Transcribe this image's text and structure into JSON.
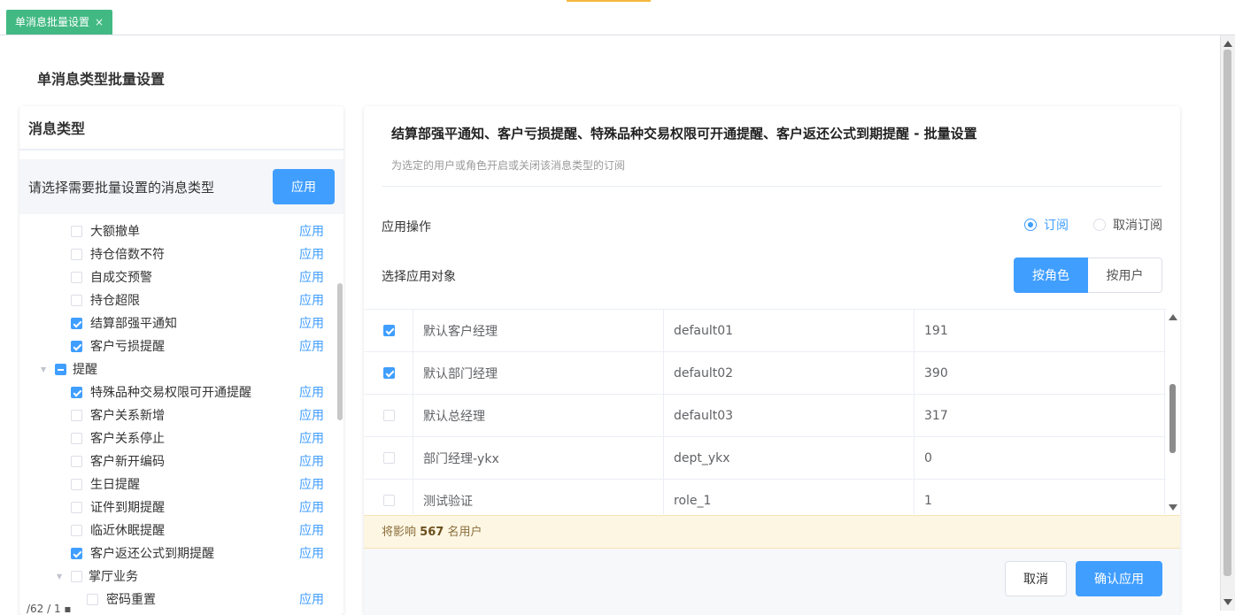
{
  "tab": {
    "label": "单消息批量设置",
    "close": "×"
  },
  "page_title": "单消息类型批量设置",
  "left": {
    "header": "消息类型",
    "prompt": "请选择需要批量设置的消息类型",
    "apply_button": "应用",
    "items": [
      {
        "label": "大额撤单",
        "checked": false,
        "apply": "应用"
      },
      {
        "label": "持仓倍数不符",
        "checked": false,
        "apply": "应用"
      },
      {
        "label": "自成交预警",
        "checked": false,
        "apply": "应用"
      },
      {
        "label": "持仓超限",
        "checked": false,
        "apply": "应用"
      },
      {
        "label": "结算部强平通知",
        "checked": true,
        "apply": "应用"
      },
      {
        "label": "客户亏损提醒",
        "checked": true,
        "apply": "应用"
      }
    ],
    "group": {
      "label": "提醒",
      "state": "indeterminate"
    },
    "group_items": [
      {
        "label": "特殊品种交易权限可开通提醒",
        "checked": true,
        "apply": "应用"
      },
      {
        "label": "客户关系新增",
        "checked": false,
        "apply": "应用"
      },
      {
        "label": "客户关系停止",
        "checked": false,
        "apply": "应用"
      },
      {
        "label": "客户新开编码",
        "checked": false,
        "apply": "应用"
      },
      {
        "label": "生日提醒",
        "checked": false,
        "apply": "应用"
      },
      {
        "label": "证件到期提醒",
        "checked": false,
        "apply": "应用"
      },
      {
        "label": "临近休眠提醒",
        "checked": false,
        "apply": "应用"
      },
      {
        "label": "客户返还公式到期提醒",
        "checked": true,
        "apply": "应用"
      }
    ],
    "group2": {
      "label": "掌厅业务"
    },
    "group2_items": [
      {
        "label": "密码重置",
        "checked": false,
        "apply": "应用"
      }
    ]
  },
  "right": {
    "title": "结算部强平通知、客户亏损提醒、特殊品种交易权限可开通提醒、客户返还公式到期提醒 - 批量设置",
    "subtitle": "为选定的用户或角色开启或关闭该消息类型的订阅",
    "operation_label": "应用操作",
    "radio_subscribe": "订阅",
    "radio_unsubscribe": "取消订阅",
    "target_label": "选择应用对象",
    "seg_role": "按角色",
    "seg_user": "按用户",
    "rows": [
      {
        "checked": true,
        "name": "默认客户经理",
        "code": "default01",
        "count": "191"
      },
      {
        "checked": true,
        "name": "默认部门经理",
        "code": "default02",
        "count": "390"
      },
      {
        "checked": false,
        "name": "默认总经理",
        "code": "default03",
        "count": "317"
      },
      {
        "checked": false,
        "name": "部门经理-ykx",
        "code": "dept_ykx",
        "count": "0"
      },
      {
        "checked": false,
        "name": "测试验证",
        "code": "role_1",
        "count": "1"
      }
    ],
    "notice_prefix": "将影响",
    "notice_count": "567",
    "notice_suffix": "名用户",
    "cancel": "取消",
    "confirm": "确认应用"
  },
  "bottom_clip": "/62 / 1 ▪"
}
